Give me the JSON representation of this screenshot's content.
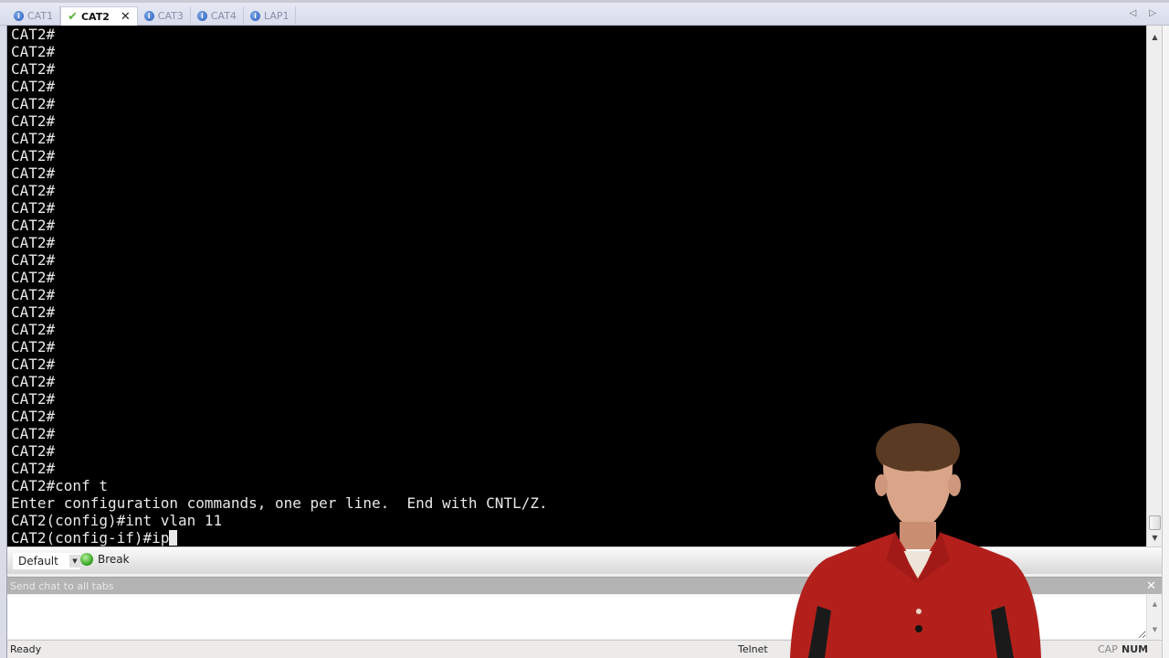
{
  "tabs": [
    {
      "label": "CAT1",
      "icon": "info-icon",
      "active": false
    },
    {
      "label": "CAT2",
      "icon": "check-icon",
      "active": true
    },
    {
      "label": "CAT3",
      "icon": "info-icon",
      "active": false
    },
    {
      "label": "CAT4",
      "icon": "info-icon",
      "active": false
    },
    {
      "label": "LAP1",
      "icon": "info-icon",
      "active": false
    }
  ],
  "tab_nav": {
    "prev": "◁",
    "next": "▷"
  },
  "terminal": {
    "prompt_repeat": "CAT2#",
    "prompt_repeat_count": 26,
    "lines": [
      "CAT2#conf t",
      "Enter configuration commands, one per line.  End with CNTL/Z.",
      "CAT2(config)#int vlan 11",
      "CAT2(config-if)#ip"
    ]
  },
  "toolbar": {
    "session_select": "Default",
    "break_label": "Break"
  },
  "chat": {
    "header": "Send chat to all tabs",
    "close": "✕",
    "value": ""
  },
  "status": {
    "ready": "Ready",
    "protocol": "Telnet",
    "cap": "CAP",
    "num": "NUM"
  },
  "colors": {
    "terminal_bg": "#000000",
    "terminal_fg": "#e8e8e8",
    "break_green": "#2d9c1a",
    "shirt_red": "#b3201c"
  }
}
